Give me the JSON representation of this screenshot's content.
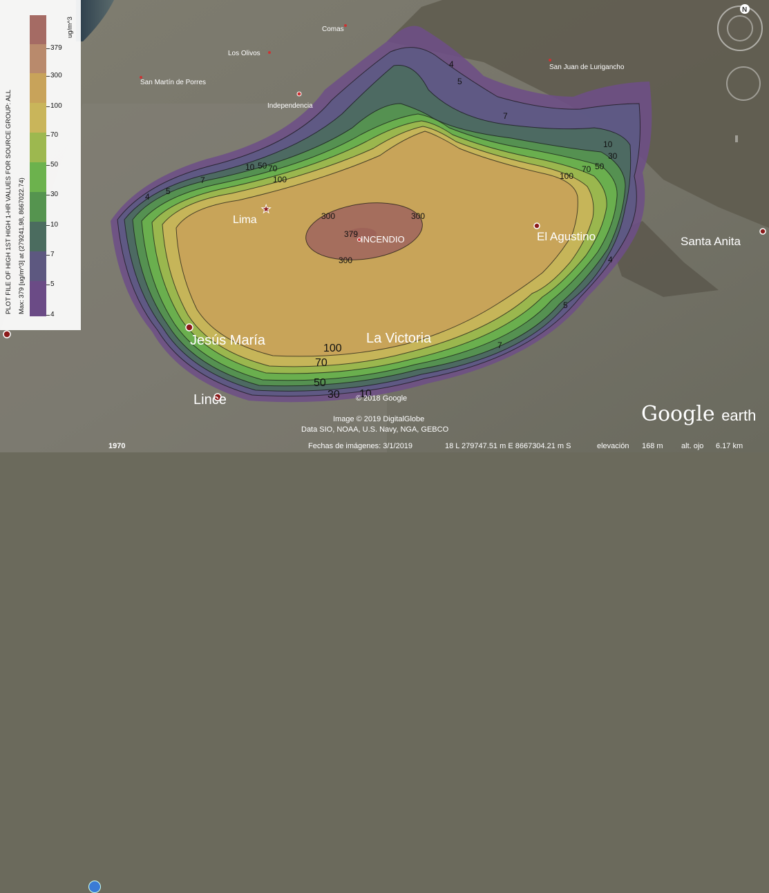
{
  "legend": {
    "units": "ug/m^3",
    "title_line1": "PLOT FILE OF HIGH 1ST HIGH 1-HR VALUES FOR SOURCE GROUP: ALL",
    "title_line2": "Max: 379 [ug/m^3] at (279241.98, 8667022.74)",
    "ticks": [
      "379",
      "300",
      "100",
      "70",
      "50",
      "30",
      "10",
      "7",
      "5",
      "4"
    ],
    "colors": [
      "#a56b64",
      "#b98a6c",
      "#c8a35a",
      "#c9b55a",
      "#9db84f",
      "#6cb24d",
      "#55944f",
      "#4b6c5f",
      "#5d5880",
      "#6b4b86",
      "#7a4e8e"
    ]
  },
  "places": {
    "comas": "Comas",
    "los_olivos": "Los Olivos",
    "smp": "San Martín de Porres",
    "independencia": "Independencia",
    "sjl": "San Juan de Lurigancho",
    "lima": "Lima",
    "el_agustino": "El Agustino",
    "santa_anita": "Santa Anita",
    "jesus_maria": "Jesús María",
    "la_victoria": "La Victoria",
    "lince": "Lince",
    "incendio": "INCENDIO"
  },
  "contour_labels": {
    "c300a": "300",
    "c300b": "300",
    "c300c": "300",
    "c379": "379",
    "c100a": "100",
    "c100b": "100",
    "c100c": "100",
    "c70a": "70",
    "c70b": "70",
    "c70c": "70",
    "c50a": "50",
    "c50b": "50",
    "c50c": "50",
    "c30a": "30",
    "c30b": "30",
    "c10a": "10",
    "c10b": "10",
    "c10c": "10",
    "c7a": "7",
    "c7b": "7",
    "c7c": "7",
    "c5a": "5",
    "c5b": "5",
    "c5c": "5",
    "c4a": "4",
    "c4b": "4",
    "c4c": "4"
  },
  "credits": {
    "google_2018": "© 2018 Google",
    "digitalglobe": "Image © 2019 DigitalGlobe",
    "data": "Data SIO, NOAA, U.S. Navy, NGA, GEBCO",
    "brand_google": "Google",
    "brand_earth": "earth",
    "compass_n": "N"
  },
  "status": {
    "year": "1970",
    "imagery_date": "Fechas de imágenes: 3/1/2019",
    "coords": "18 L 279747.51 m E 8667304.21 m S",
    "elevation_label": "elevación",
    "elevation": "168 m",
    "eye_label": "alt. ojo",
    "eye": "6.17 km"
  }
}
